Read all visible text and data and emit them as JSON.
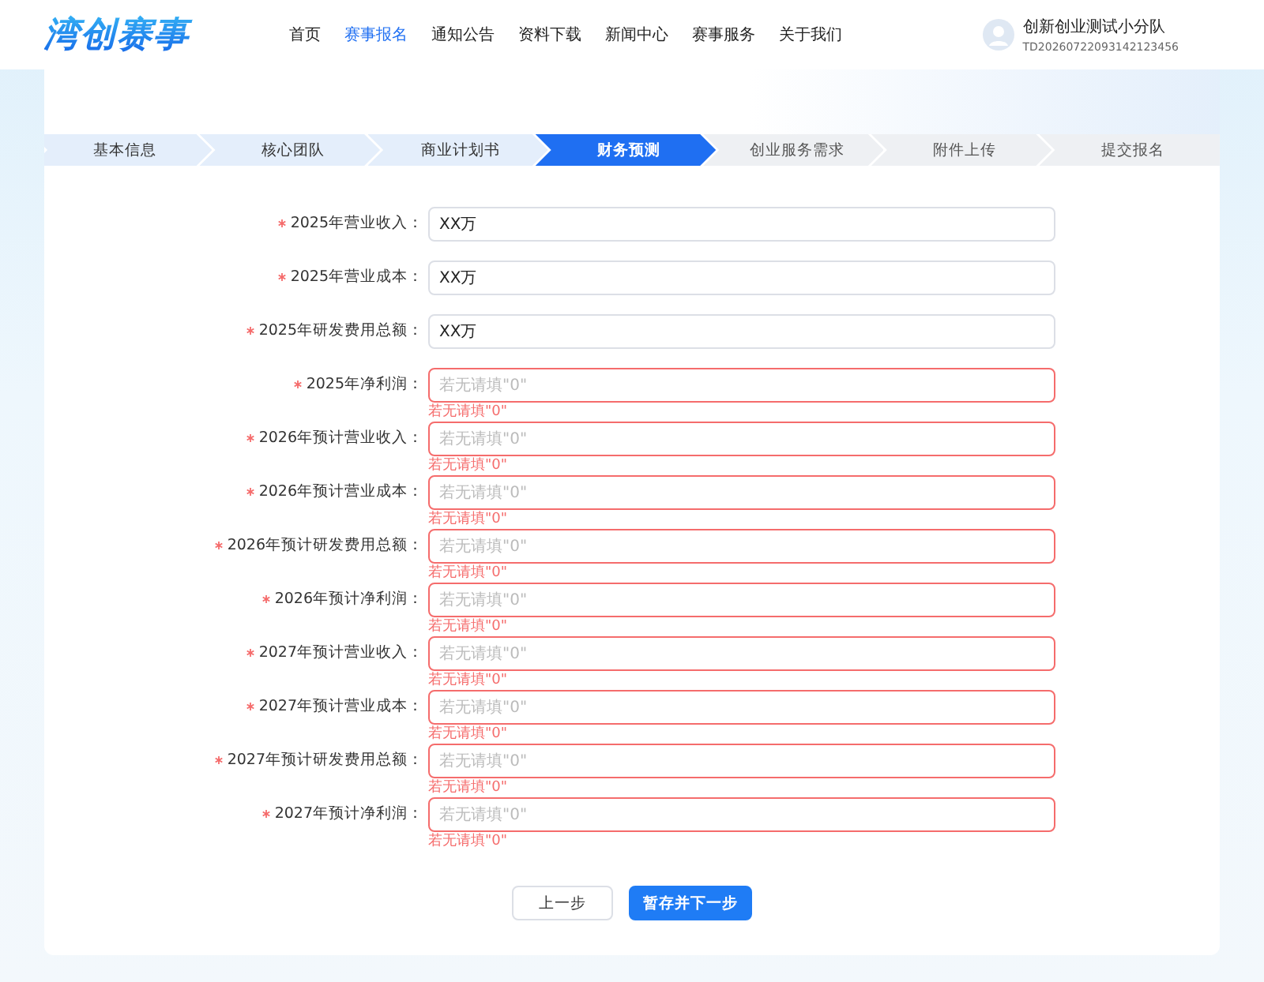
{
  "header": {
    "logo": "湾创赛事",
    "nav": [
      {
        "label": "首页",
        "selected": false
      },
      {
        "label": "赛事报名",
        "selected": true
      },
      {
        "label": "通知公告",
        "selected": false
      },
      {
        "label": "资料下载",
        "selected": false
      },
      {
        "label": "新闻中心",
        "selected": false
      },
      {
        "label": "赛事服务",
        "selected": false
      },
      {
        "label": "关于我们",
        "selected": false
      }
    ],
    "user": {
      "name": "创新创业测试小分队",
      "id": "TD20260722093142123456"
    }
  },
  "steps": [
    {
      "label": "基本信息",
      "selected": false,
      "completed": true
    },
    {
      "label": "核心团队",
      "selected": false,
      "completed": true
    },
    {
      "label": "商业计划书",
      "selected": false,
      "completed": true
    },
    {
      "label": "财务预测",
      "selected": true,
      "completed": false
    },
    {
      "label": "创业服务需求",
      "selected": false,
      "completed": false
    },
    {
      "label": "附件上传",
      "selected": false,
      "completed": false
    },
    {
      "label": "提交报名",
      "selected": false,
      "completed": false
    }
  ],
  "fields": [
    {
      "label": "2025年营业收入：",
      "required": true,
      "value": "XX万",
      "invalid": false
    },
    {
      "label": "2025年营业成本：",
      "required": true,
      "value": "XX万",
      "invalid": false
    },
    {
      "label": "2025年研发费用总额：",
      "required": true,
      "value": "XX万",
      "invalid": false
    },
    {
      "label": "2025年净利润：",
      "required": true,
      "placeholder": "若无请填\"0\"",
      "invalid": true,
      "error": "若无请填\"0\""
    },
    {
      "label": "2026年预计营业收入：",
      "required": true,
      "placeholder": "若无请填\"0\"",
      "invalid": true,
      "error": "若无请填\"0\""
    },
    {
      "label": "2026年预计营业成本：",
      "required": true,
      "placeholder": "若无请填\"0\"",
      "invalid": true,
      "error": "若无请填\"0\""
    },
    {
      "label": "2026年预计研发费用总额：",
      "required": true,
      "placeholder": "若无请填\"0\"",
      "invalid": true,
      "error": "若无请填\"0\""
    },
    {
      "label": "2026年预计净利润：",
      "required": true,
      "placeholder": "若无请填\"0\"",
      "invalid": true,
      "error": "若无请填\"0\""
    },
    {
      "label": "2027年预计营业收入：",
      "required": true,
      "placeholder": "若无请填\"0\"",
      "invalid": true,
      "error": "若无请填\"0\""
    },
    {
      "label": "2027年预计营业成本：",
      "required": true,
      "placeholder": "若无请填\"0\"",
      "invalid": true,
      "error": "若无请填\"0\""
    },
    {
      "label": "2027年预计研发费用总额：",
      "required": true,
      "placeholder": "若无请填\"0\"",
      "invalid": true,
      "error": "若无请填\"0\""
    },
    {
      "label": "2027年预计净利润：",
      "required": true,
      "placeholder": "若无请填\"0\"",
      "invalid": true,
      "error": "若无请填\"0\""
    }
  ],
  "buttons": [
    {
      "label": "上一步",
      "kind": "secondary"
    },
    {
      "label": "暂存并下一步",
      "kind": "primary"
    }
  ]
}
